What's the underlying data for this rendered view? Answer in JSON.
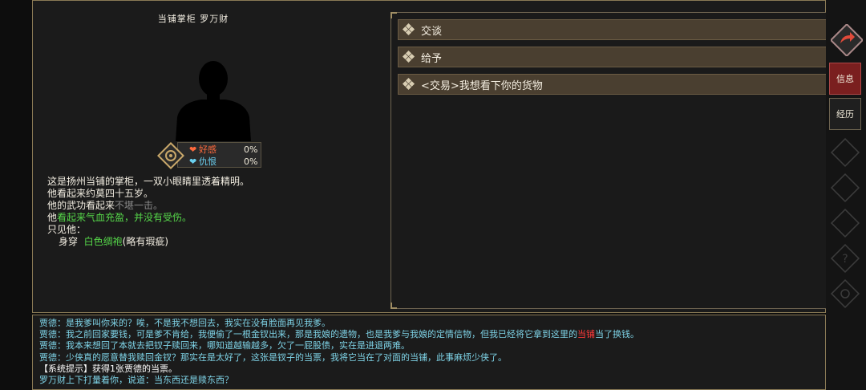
{
  "npc": {
    "title": "当铺掌柜  罗万财",
    "relations": [
      {
        "label": "好感",
        "value": "0%",
        "color": "#ff6a3d"
      },
      {
        "label": "仇恨",
        "value": "0%",
        "color": "#6ad0f0"
      }
    ],
    "description": {
      "line1": "这是扬州当铺的掌柜，一双小眼睛里透着精明。",
      "line2": "他看起来约莫四十五岁。",
      "line3_prefix": "他的武功看起来",
      "line3_hl": "不堪一击。",
      "line4_prefix": "他",
      "line4_hl": "看起来气血充盈，并没有受伤。",
      "line5": "只见他：",
      "wear_label": "身穿",
      "wear_item": "白色绸袍",
      "wear_note": "(略有瑕疵)"
    }
  },
  "options": [
    "交谈",
    "给予",
    "<交易>我想看下你的货物"
  ],
  "log": {
    "l1": "贾德：是我爹叫你来的？唉，不是我不想回去，我实在没有脸面再见我爹。",
    "l2a": "贾德：我之前回家要钱，可是爹不肯给，我便偷了一根金钗出来，那是我娘的遗物，也是我爹与我娘的定情信物，但我已经将它拿到这里的",
    "l2b": "当铺",
    "l2c": "当了换钱。",
    "l3": "贾德：我本来想回了本就去把钗子赎回来，哪知道越输越多，欠了一屁股债，实在是进退两难。",
    "l4": "贾德：少侠真的愿意替我赎回金钗？那实在是太好了，这张是钗子的当票，我将它当在了对面的当铺，此事麻烦少侠了。",
    "l5": "【系统提示】获得1张贾德的当票。",
    "l6": "罗万财上下打量着你，说道：当东西还是赎东西？"
  },
  "sidebar": {
    "info": "信息",
    "history": "经历"
  }
}
